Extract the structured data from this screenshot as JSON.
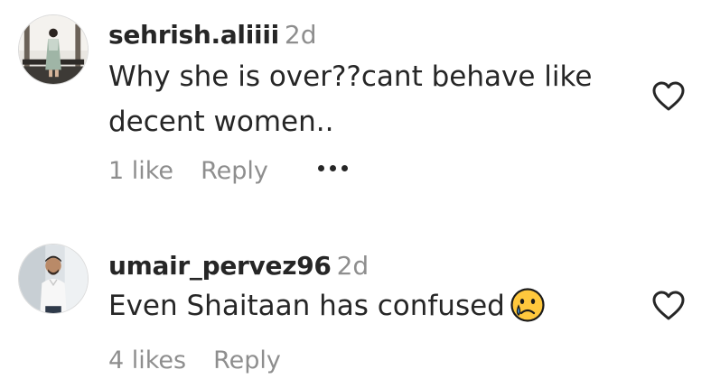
{
  "comments": [
    {
      "username": "sehrish.aliiii",
      "time": "2d",
      "text_lines": [
        "Why she is over??cant behave like",
        "decent women.."
      ],
      "likes": "1 like",
      "reply": "Reply",
      "avatar_icon": "profile-photo",
      "like_icon": "heart-outline-icon",
      "more_icon": "more-options-icon"
    },
    {
      "username": "umair_pervez96",
      "time": "2d",
      "text": "Even Shaitaan has confused",
      "emoji": "crying-face-emoji",
      "likes": "4 likes",
      "reply": "Reply",
      "avatar_icon": "profile-photo",
      "like_icon": "heart-outline-icon"
    }
  ],
  "colors": {
    "primary_text": "#262626",
    "secondary_text": "#8e8e8e",
    "background": "#ffffff"
  }
}
